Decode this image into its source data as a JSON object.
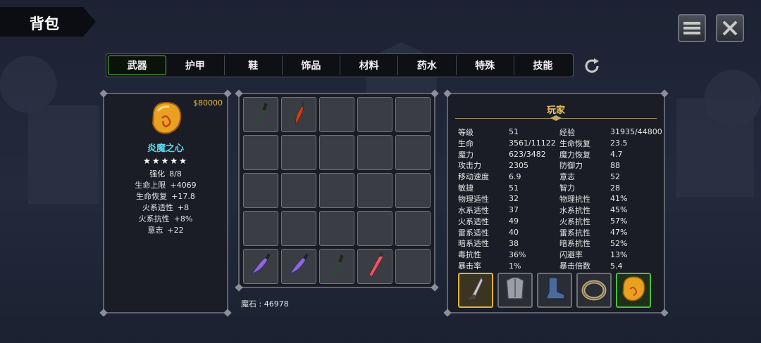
{
  "title": "背包",
  "tabs": [
    {
      "label": "武器",
      "active": true
    },
    {
      "label": "护甲",
      "active": false
    },
    {
      "label": "鞋",
      "active": false
    },
    {
      "label": "饰品",
      "active": false
    },
    {
      "label": "材料",
      "active": false
    },
    {
      "label": "药水",
      "active": false
    },
    {
      "label": "特殊",
      "active": false
    },
    {
      "label": "技能",
      "active": false
    }
  ],
  "buttons": {
    "menu": "menu-icon",
    "close": "close-icon",
    "refresh": "refresh-icon"
  },
  "selected_item": {
    "price": "$80000",
    "name": "炎魔之心",
    "stars": "★★★★★",
    "icon": "flame-heart-gem-icon",
    "stats": [
      {
        "key": "强化",
        "value": "8/8"
      },
      {
        "key": "生命上限",
        "value": "+4069"
      },
      {
        "key": "生命恢复",
        "value": "+17.8"
      },
      {
        "key": "火系适性",
        "value": "+8"
      },
      {
        "key": "火系抗性",
        "value": "+8%"
      },
      {
        "key": "意志",
        "value": "+22"
      }
    ]
  },
  "inventory": {
    "currency": "魔石 : 46978",
    "slots": [
      "green-dagger-icon",
      "red-curved-dagger-icon",
      "",
      "",
      "",
      "",
      "",
      "",
      "",
      "",
      "",
      "",
      "",
      "",
      "",
      "",
      "",
      "",
      "",
      "",
      "purple-dagger-icon",
      "purple-dagger-icon",
      "green-dagger-icon",
      "red-dagger-icon",
      ""
    ]
  },
  "player": {
    "title": "玩家",
    "stats": [
      [
        "等级",
        "51",
        "经验",
        "31935/44800"
      ],
      [
        "生命",
        "3561/11122",
        "生命恢复",
        "23.5"
      ],
      [
        "魔力",
        "623/3482",
        "魔力恢复",
        "4.7"
      ],
      [
        "攻击力",
        "2305",
        "防御力",
        "88"
      ],
      [
        "移动速度",
        "6.9",
        "意志",
        "52"
      ],
      [
        "敏捷",
        "51",
        "智力",
        "28"
      ],
      [
        "物理适性",
        "32",
        "物理抗性",
        "41%"
      ],
      [
        "水系适性",
        "37",
        "水系抗性",
        "45%"
      ],
      [
        "火系适性",
        "49",
        "火系抗性",
        "57%"
      ],
      [
        "雷系适性",
        "40",
        "雷系抗性",
        "47%"
      ],
      [
        "暗系适性",
        "38",
        "暗系抗性",
        "52%"
      ],
      [
        "毒抗性",
        "36%",
        "闪避率",
        "13%"
      ],
      [
        "暴击率",
        "1%",
        "暴击倍数",
        "5.4"
      ]
    ],
    "equipment": [
      {
        "icon": "dagger-icon",
        "frame": "gold"
      },
      {
        "icon": "armor-icon",
        "frame": "gray"
      },
      {
        "icon": "boots-icon",
        "frame": "gray"
      },
      {
        "icon": "ring-icon",
        "frame": "gray"
      },
      {
        "icon": "flame-heart-gem-icon",
        "frame": "green"
      }
    ]
  },
  "colors": {
    "accent_green": "#57c247",
    "gold": "#e8c25a",
    "item_name": "#5fd9f0",
    "price": "#e8b84a"
  }
}
